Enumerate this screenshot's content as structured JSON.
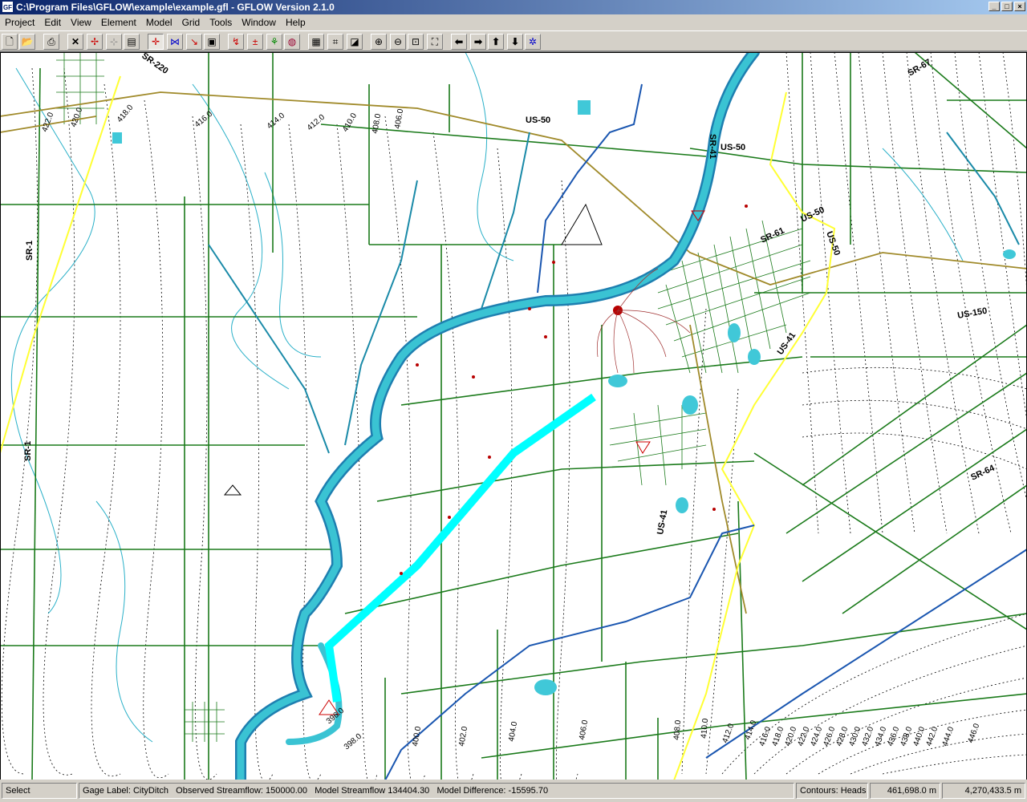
{
  "window": {
    "title": "C:\\Program Files\\GFLOW\\example\\example.gfl - GFLOW Version 2.1.0",
    "icon_text": "GF",
    "buttons": {
      "minimize": "_",
      "maximize": "□",
      "close": "×"
    }
  },
  "menu": [
    "Project",
    "Edit",
    "View",
    "Element",
    "Model",
    "Grid",
    "Tools",
    "Window",
    "Help"
  ],
  "toolbar_icons": [
    "new-file-icon",
    "open-folder-icon",
    "print-icon",
    "delete-icon",
    "move-vertex-icon",
    "add-vertex-icon",
    "properties-icon",
    "well-icon",
    "line-sink-icon",
    "head-specified-icon",
    "inhomogeneity-icon",
    "trace-pathline-icon",
    "gage-icon",
    "test-point-icon",
    "run-solver-icon",
    "spreadsheet-icon",
    "grid-icon",
    "contour-icon",
    "zoom-in-icon",
    "zoom-out-icon",
    "zoom-window-icon",
    "zoom-extents-icon",
    "pan-left-icon",
    "pan-right-icon",
    "pan-up-icon",
    "pan-down-icon",
    "center-icon"
  ],
  "map": {
    "road_labels": [
      "SR-220",
      "US-50",
      "SR-1",
      "SR-1",
      "US-50",
      "SR-41",
      "SR-61",
      "US-50",
      "US-50",
      "US-150",
      "US-41",
      "SR-64",
      "US-41",
      "SR-67"
    ],
    "contour_labels": [
      "422.0",
      "420.0",
      "418.0",
      "416.0",
      "414.0",
      "412.0",
      "410.0",
      "408.0",
      "406.0",
      "398.0",
      "400.0",
      "402.0",
      "404.0",
      "406.0",
      "408.0",
      "410.0",
      "412.0",
      "414.0",
      "416.0",
      "418.0",
      "420.0",
      "422.0",
      "424.0",
      "426.0",
      "428.0",
      "430.0",
      "432.0",
      "434.0",
      "436.0",
      "438.0",
      "440.0",
      "442.0",
      "444.0",
      "446.0",
      "396.0"
    ],
    "colors": {
      "roads": "#1a7a1a",
      "rivers": "#1aa3b8",
      "streams": "#2ab0c8",
      "highway": "#ffff33",
      "railroad": "#a08a2a",
      "lake": "#40c8d8",
      "contour": "#000000",
      "wells": "#b80000"
    }
  },
  "status": {
    "mode": "Select",
    "gage_label": "Gage Label: CityDitch",
    "observed": "Observed Streamflow: 150000.00",
    "model": "Model Streamflow 134404.30",
    "difference": "Model Difference: -15595.70",
    "contours": "Contours: Heads",
    "x_coord": "461,698.0 m",
    "y_coord": "4,270,433.5 m"
  }
}
